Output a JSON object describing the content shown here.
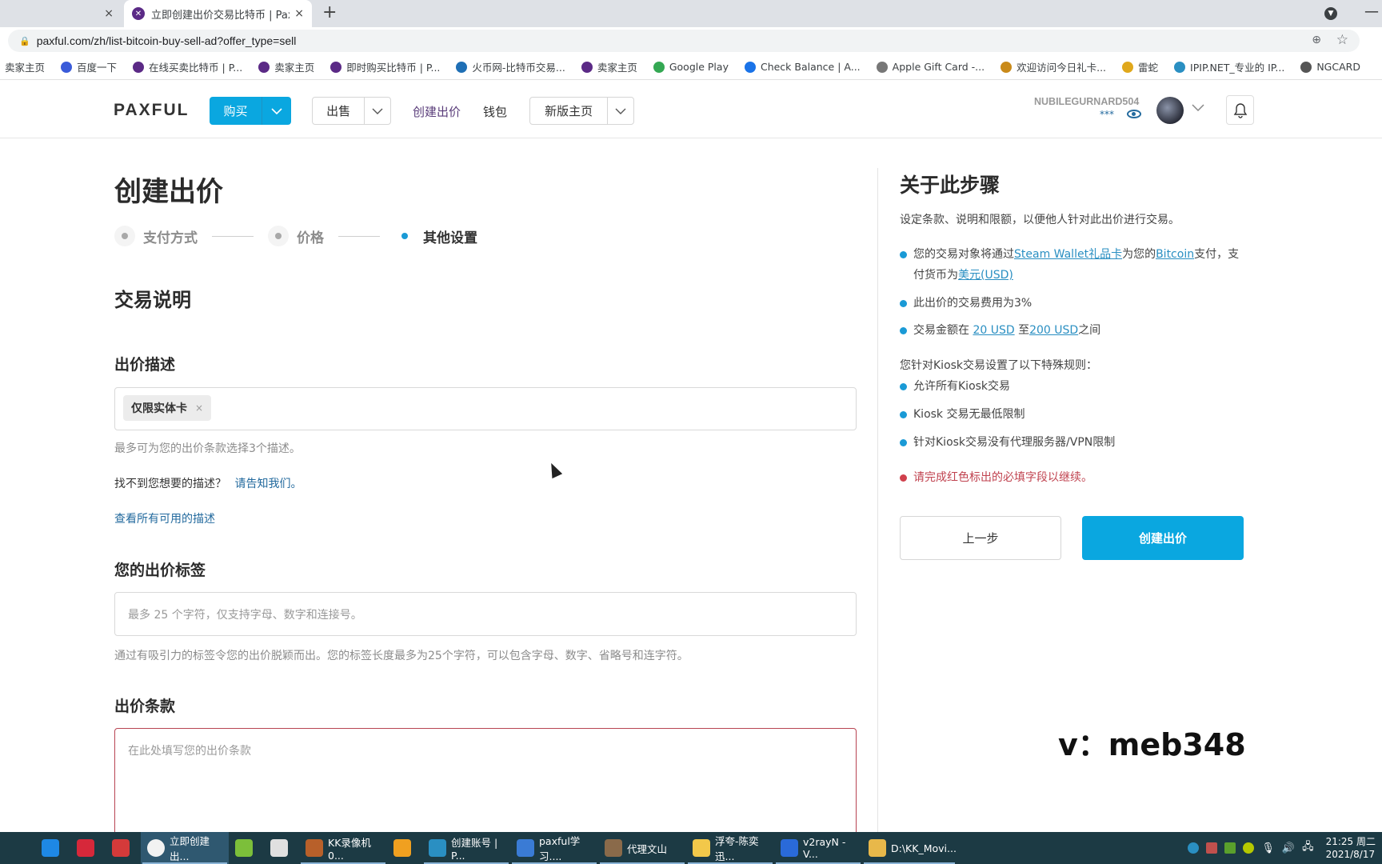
{
  "browser": {
    "inactive_tab_close": "×",
    "active_tab": {
      "title": "立即创建出价交易比特币 | Paxful",
      "close": "×"
    },
    "new_tab": "+",
    "url": "paxful.com/zh/list-bitcoin-buy-sell-ad?offer_type=sell",
    "bookmarks": [
      {
        "label": "卖家主页",
        "icon": "none",
        "color": ""
      },
      {
        "label": "百度一下",
        "icon": "baidu-paw-icon",
        "color": "#3a5bd9"
      },
      {
        "label": "在线买卖比特币 | P...",
        "icon": "paxful-icon",
        "color": "#5b2a86"
      },
      {
        "label": "卖家主页",
        "icon": "paxful-icon",
        "color": "#5b2a86"
      },
      {
        "label": "即时购买比特币 | P...",
        "icon": "paxful-icon",
        "color": "#5b2a86"
      },
      {
        "label": "火币网-比特币交易...",
        "icon": "huobi-flame-icon",
        "color": "#1f6fb5"
      },
      {
        "label": "卖家主页",
        "icon": "paxful-icon",
        "color": "#5b2a86"
      },
      {
        "label": "Google Play",
        "icon": "google-play-icon",
        "color": "#34a853"
      },
      {
        "label": "Check Balance | A...",
        "icon": "square-blue-icon",
        "color": "#1a73e8"
      },
      {
        "label": "Apple Gift Card -...",
        "icon": "apple-icon",
        "color": "#777777"
      },
      {
        "label": "欢迎访问今日礼卡...",
        "icon": "gift-card-icon",
        "color": "#c98a1a"
      },
      {
        "label": "雷蛇",
        "icon": "coin-icon",
        "color": "#e0a81c"
      },
      {
        "label": "IPIP.NET_专业的 IP...",
        "icon": "ipip-icon",
        "color": "#2a8fc2"
      },
      {
        "label": "NGCARD",
        "icon": "globe-icon",
        "color": "#555555"
      }
    ]
  },
  "header": {
    "logo": "PAXFUL",
    "buy_label": "购买",
    "sell_label": "出售",
    "create_offer_link": "创建出价",
    "wallet_link": "钱包",
    "new_home_label": "新版主页",
    "username": "NUBILEGURNARD504",
    "balance_masked": "***"
  },
  "page": {
    "title": "创建出价",
    "steps": [
      {
        "label": "支付方式",
        "state": "done"
      },
      {
        "label": "价格",
        "state": "done"
      },
      {
        "label": "其他设置",
        "state": "active"
      }
    ],
    "section_title": "交易说明",
    "description": {
      "label": "出价描述",
      "tags": [
        {
          "text": "仅限实体卡",
          "remove": "×"
        }
      ],
      "help": "最多可为您的出价条款选择3个描述。",
      "not_found": "找不到您想要的描述？",
      "tell_us_link": "请告知我们。",
      "view_all_link": "查看所有可用的描述"
    },
    "offer_tag": {
      "label": "您的出价标签",
      "placeholder": "最多 25 个字符，仅支持字母、数字和连接号。",
      "help": "通过有吸引力的标签令您的出价脱颖而出。您的标签长度最多为25个字符，可以包含字母、数字、省略号和连字符。"
    },
    "offer_terms": {
      "label": "出价条款",
      "placeholder": "在此处填写您的出价条款"
    }
  },
  "sidebar": {
    "title": "关于此步骤",
    "intro": "设定条款、说明和限额，以便他人针对此出价进行交易。",
    "payment": {
      "prefix": "您的交易对象将通过",
      "method_link": "Steam Wallet礼品卡",
      "mid": "为您的",
      "crypto_link": "Bitcoin",
      "mid2": "支付，支付货币为",
      "currency_link": "美元(USD)"
    },
    "fee": "此出价的交易费用为3%",
    "limits": {
      "prefix": "交易金额在 ",
      "min_link": "20 USD",
      "mid": " 至",
      "max_link": "200 USD",
      "suffix": "之间"
    },
    "kiosk_intro": "您针对Kiosk交易设置了以下特殊规则：",
    "kiosk_rules": [
      "允许所有Kiosk交易",
      "Kiosk 交易无最低限制",
      "针对Kiosk交易没有代理服务器/VPN限制"
    ],
    "error": "请完成红色标出的必填字段以继续。",
    "prev_button": "上一步",
    "create_button": "创建出价",
    "accent_color": "#0aa7e0",
    "error_color": "#c0424f"
  },
  "watermark": "v：meb348",
  "taskbar": {
    "items": [
      {
        "label": "",
        "icon": "task-view-icon"
      },
      {
        "label": "",
        "icon": "internet-explorer-icon"
      },
      {
        "label": "",
        "icon": "youdao-icon"
      },
      {
        "label": "",
        "icon": "netease-music-icon"
      },
      {
        "label": "立即创建出...",
        "icon": "chrome-icon",
        "active": true
      },
      {
        "label": "",
        "icon": "green-browser-icon"
      },
      {
        "label": "",
        "icon": "calculator-icon"
      },
      {
        "label": "KK录像机 0...",
        "icon": "kk-recorder-icon"
      },
      {
        "label": "",
        "icon": "app-orange-icon"
      },
      {
        "label": "创建账号 | P...",
        "icon": "ie-icon"
      },
      {
        "label": "paxful学习....",
        "icon": "visio-icon"
      },
      {
        "label": "代理文山",
        "icon": "contact-avatar-icon"
      },
      {
        "label": "浮夸-陈奕迅...",
        "icon": "kugou-icon"
      },
      {
        "label": "v2rayN - V...",
        "icon": "v2ray-icon"
      },
      {
        "label": "D:\\KK_Movi...",
        "icon": "folder-icon"
      }
    ],
    "time": "21:25 周二",
    "date": "2021/8/17"
  }
}
